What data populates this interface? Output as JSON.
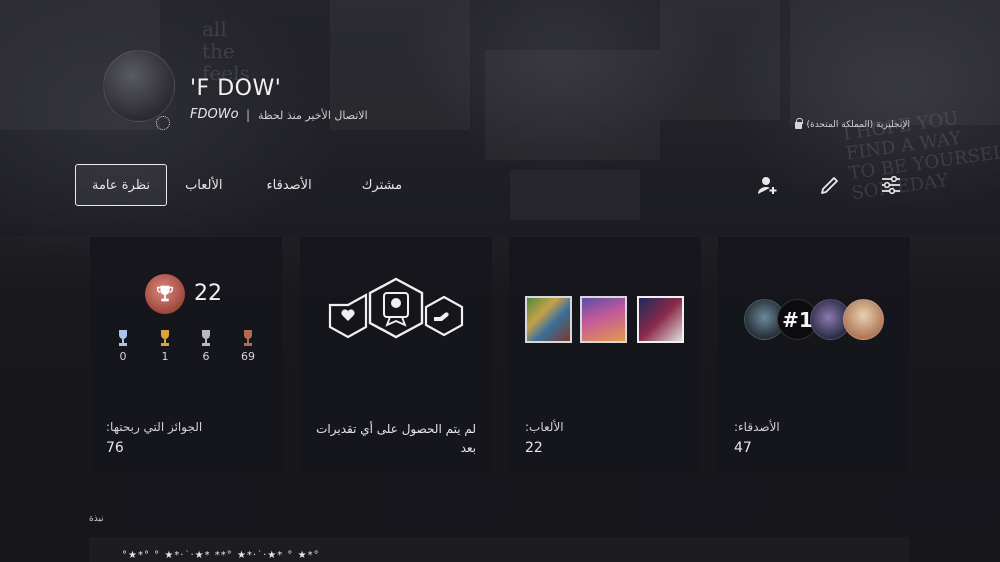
{
  "profile": {
    "online_id": "'F DOW'",
    "psn_id": "FDOWo",
    "separator": "|",
    "last_online": "الاتصال الأخير منذ لحظة",
    "language": "الإنجليزية (المملكة المتحدة)"
  },
  "background": {
    "text_left": "all\nthe\nfeels",
    "text_right": "I HOPE YOU\nFIND A WAY\nTO BE YOURSELF\nSOMEDAY"
  },
  "tabs": [
    {
      "label": "نظرة عامة",
      "active": true
    },
    {
      "label": "الألعاب",
      "active": false
    },
    {
      "label": "الأصدقاء",
      "active": false
    },
    {
      "label": "مشترك",
      "active": false
    }
  ],
  "actions": {
    "filter_icon": "sliders-icon",
    "edit_icon": "pencil-icon",
    "friend_icon": "add-friend-icon"
  },
  "trophies": {
    "level": "22",
    "platinum": "0",
    "gold": "1",
    "silver": "6",
    "bronze": "69",
    "label": "الجوائز التي ربحتها:",
    "total": "76",
    "colors": {
      "platinum": "#a9c6e8",
      "gold": "#d7a53c",
      "silver": "#b8b8be",
      "bronze": "#b46a52",
      "level_badge": "#b3473c"
    }
  },
  "badges": {
    "message": "لم يتم الحصول على أي تقديرات بعد"
  },
  "games": {
    "label": "الألعاب:",
    "count": "22",
    "thumbnails": [
      "gta-v-cover",
      "rocket-arena-cover",
      "fifa-cover"
    ]
  },
  "friends": {
    "label": "الأصدقاء:",
    "count": "47",
    "avatar_text": "#1"
  },
  "about": {
    "label": "نبذة",
    "text": "°★*° ° ★*·˙·★* **° ★*·˙·★* ° ★*°"
  }
}
